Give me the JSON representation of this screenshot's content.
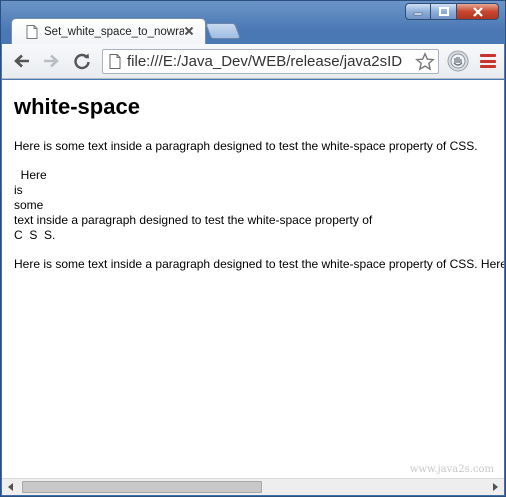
{
  "tab": {
    "title": "Set_white_space_to_nowrap",
    "favicon": "page-icon"
  },
  "toolbar": {
    "url": "file:///E:/Java_Dev/WEB/release/java2sID",
    "menu_color": "#c9332b"
  },
  "page": {
    "heading": "white-space",
    "paragraph_normal": "Here is some text inside a paragraph designed to test the white-space property of CSS.",
    "paragraph_pre": "  Here\nis\nsome\ntext inside a paragraph designed to test the white-space property of\nC  S  S.",
    "paragraph_nowrap": "Here is some text inside a paragraph designed to test the white-space property of CSS. Here is some text"
  },
  "watermark": "www.java2s.com",
  "scrollbar": {
    "position_fraction": 0.0
  }
}
